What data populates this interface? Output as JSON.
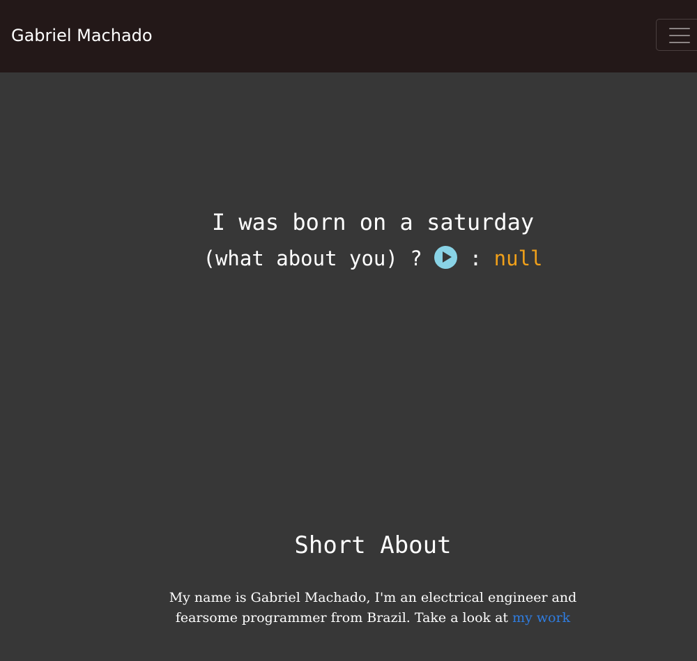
{
  "navbar": {
    "brand": "Gabriel Machado",
    "toggler_icon": "hamburger-menu-icon"
  },
  "hero": {
    "line1": "I was born on a saturday",
    "line2_prefix": "(what about you) ?",
    "play_icon": "play-icon",
    "separator": ":",
    "null_value": "null"
  },
  "about": {
    "title": "Short About",
    "text_before_link": "My name is Gabriel Machado, I'm an electrical engineer and fearsome programmer from Brazil. Take a look at",
    "link_text": "my work"
  },
  "colors": {
    "navbar_bg": "#231818",
    "page_bg": "#373737",
    "play_button": "#89d3e6",
    "null_value": "#f0a01a",
    "link": "#2f7de1"
  }
}
